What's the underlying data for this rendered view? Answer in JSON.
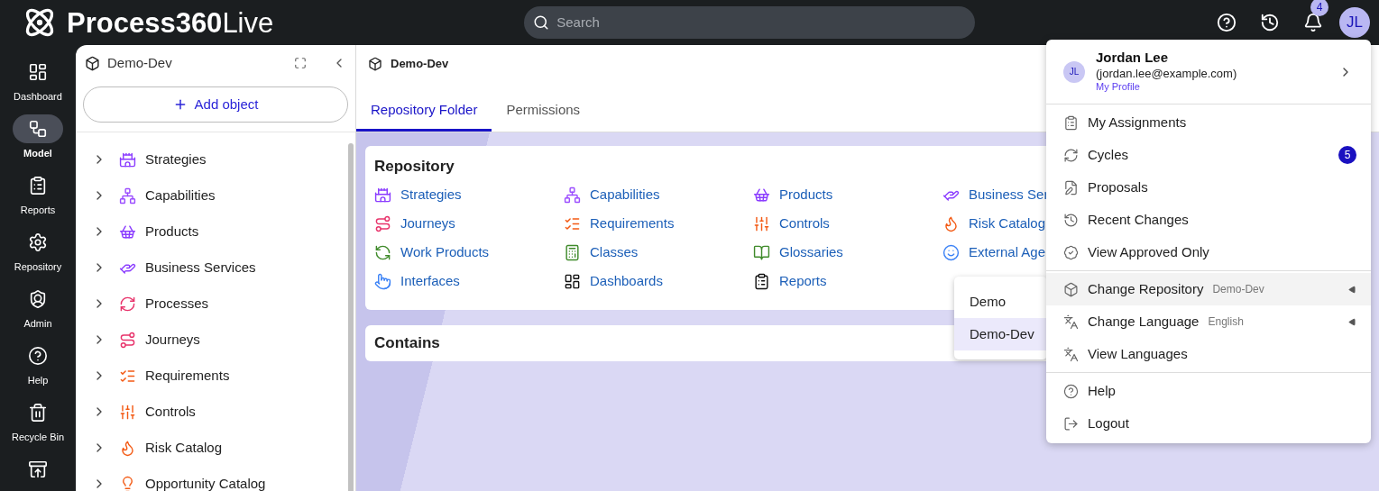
{
  "app": {
    "logo_bold": "Process360",
    "logo_light": "Live"
  },
  "search": {
    "placeholder": "Search"
  },
  "header_actions": {
    "notification_count": "4",
    "avatar_initials": "JL"
  },
  "nav": [
    {
      "label": "Dashboard",
      "kind": "dashboard",
      "selected": false
    },
    {
      "label": "Model",
      "kind": "model",
      "selected": true
    },
    {
      "label": "Reports",
      "kind": "reports",
      "selected": false
    },
    {
      "label": "Repository",
      "kind": "repository",
      "selected": false
    },
    {
      "label": "Admin",
      "kind": "admin",
      "selected": false
    },
    {
      "label": "Help",
      "kind": "help",
      "selected": false
    },
    {
      "label": "Recycle Bin",
      "kind": "recycle",
      "selected": false
    },
    {
      "kind": "import",
      "selected": false
    }
  ],
  "tree_panel": {
    "title": "Demo-Dev",
    "add_button": "Add object",
    "items": [
      {
        "label": "Strategies",
        "kind": "strategy",
        "expanded": false
      },
      {
        "label": "Capabilities",
        "kind": "capability",
        "expanded": false
      },
      {
        "label": "Products",
        "kind": "product",
        "expanded": false
      },
      {
        "label": "Business Services",
        "kind": "service",
        "expanded": false
      },
      {
        "label": "Processes",
        "kind": "process",
        "expanded": false
      },
      {
        "label": "Journeys",
        "kind": "journey",
        "expanded": false
      },
      {
        "label": "Requirements",
        "kind": "requirement",
        "expanded": false
      },
      {
        "label": "Controls",
        "kind": "control",
        "expanded": false
      },
      {
        "label": "Risk Catalog",
        "kind": "risk",
        "expanded": false
      },
      {
        "label": "Opportunity Catalog",
        "kind": "opportunity",
        "expanded": false
      }
    ]
  },
  "main": {
    "title": "Demo-Dev",
    "tabs": [
      {
        "label": "Repository Folder",
        "selected": true
      },
      {
        "label": "Permissions",
        "selected": false
      }
    ],
    "repository": {
      "title": "Repository",
      "items": [
        {
          "label": "Strategies",
          "kind": "strategy"
        },
        {
          "label": "Capabilities",
          "kind": "capability"
        },
        {
          "label": "Products",
          "kind": "product"
        },
        {
          "label": "Business Ser",
          "kind": "service"
        },
        {
          "label": "Journeys",
          "kind": "journey"
        },
        {
          "label": "Requirements",
          "kind": "requirement"
        },
        {
          "label": "Controls",
          "kind": "control"
        },
        {
          "label": "Risk Catalog",
          "kind": "risk"
        },
        {
          "label": "Work Products",
          "kind": "workproduct"
        },
        {
          "label": "Classes",
          "kind": "class"
        },
        {
          "label": "Glossaries",
          "kind": "glossary"
        },
        {
          "label": "External Age",
          "kind": "agent"
        },
        {
          "label": "Interfaces",
          "kind": "interface"
        },
        {
          "label": "Dashboards",
          "kind": "dashboard"
        },
        {
          "label": "Reports",
          "kind": "report"
        }
      ]
    },
    "contains": {
      "title": "Contains"
    }
  },
  "user_menu": {
    "initials": "JL",
    "name": "Jordan Lee",
    "email": "(jordan.lee@example.com)",
    "profile_link": "My Profile",
    "sections": [
      [
        {
          "label": "My Assignments",
          "kind": "assignments"
        },
        {
          "label": "Cycles",
          "kind": "cycles",
          "badge": "5"
        },
        {
          "label": "Proposals",
          "kind": "proposals"
        },
        {
          "label": "Recent Changes",
          "kind": "recent"
        },
        {
          "label": "View Approved Only",
          "kind": "approved"
        }
      ],
      [
        {
          "label": "Change Repository",
          "kind": "repository",
          "value": "Demo-Dev",
          "expanded": true
        },
        {
          "label": "Change Language",
          "kind": "language",
          "value": "English",
          "expanded": false
        },
        {
          "label": "View Languages",
          "kind": "languages"
        }
      ],
      [
        {
          "label": "Help",
          "kind": "help"
        },
        {
          "label": "Logout",
          "kind": "logout"
        }
      ]
    ]
  },
  "repository_submenu": {
    "items": [
      {
        "label": "Demo",
        "selected": false
      },
      {
        "label": "Demo-Dev",
        "selected": true
      }
    ]
  }
}
